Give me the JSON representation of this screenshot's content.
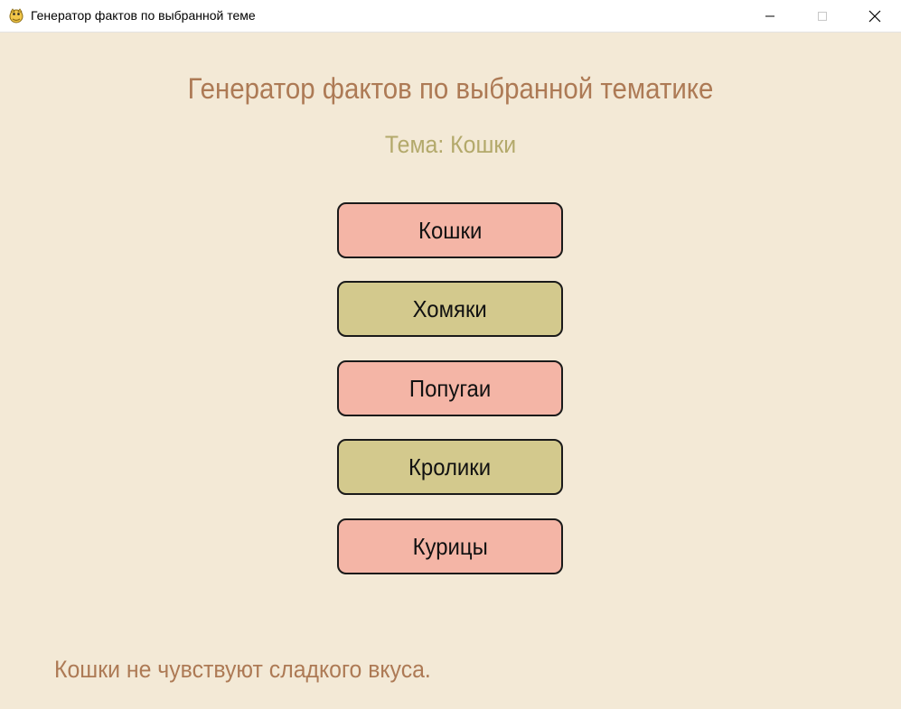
{
  "window": {
    "title": "Генератор фактов по выбранной теме",
    "icon": "python-snake-icon"
  },
  "main": {
    "heading": "Генератор фактов по выбранной тематике",
    "topic_label": "Тема: Кошки",
    "topics": [
      {
        "label": "Кошки",
        "color": "#f4b5a6"
      },
      {
        "label": "Хомяки",
        "color": "#d3c98d"
      },
      {
        "label": "Попугаи",
        "color": "#f4b5a6"
      },
      {
        "label": "Кролики",
        "color": "#d3c98d"
      },
      {
        "label": "Курицы",
        "color": "#f4b5a6"
      }
    ],
    "fact": "Кошки не чувствуют сладкого вкуса."
  },
  "colors": {
    "background": "#f3e9d6",
    "heading": "#ad7a55",
    "topic_label": "#b3a96b",
    "fact": "#ad7a55"
  }
}
